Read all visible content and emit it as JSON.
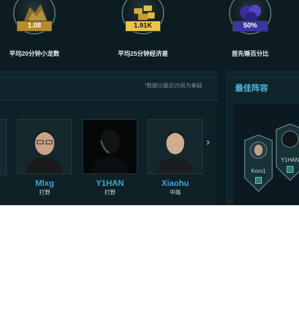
{
  "stats": [
    {
      "value": "1.08",
      "label": "平均20分钟小龙数",
      "icon": "gold-trophy-icon",
      "badge_bg": "#b88a2c",
      "badge_fg": "#ffffff"
    },
    {
      "value": "1.91K",
      "label": "平均25分钟经济差",
      "icon": "gold-coins-icon",
      "badge_bg": "#e9c44a",
      "badge_fg": "#1b1b1b"
    },
    {
      "value": "50%",
      "label": "首先锤百分比",
      "icon": "purple-crystal-icon",
      "badge_bg": "#3b35a6",
      "badge_fg": "#ffffff"
    }
  ],
  "players_panel": {
    "note_star": "*",
    "note": "数据以最近25局为基础",
    "players": [
      {
        "name": "Mlxg",
        "role": "打野"
      },
      {
        "name": "Y1HAN",
        "role": "打野"
      },
      {
        "name": "Xiaohu",
        "role": "中路"
      }
    ]
  },
  "lineup_panel": {
    "title": "最佳阵容",
    "members": [
      {
        "name": "Koro1"
      },
      {
        "name": "Y1HAN"
      }
    ]
  },
  "colors": {
    "background": "#0d1b22",
    "panel": "#10242c",
    "accent_blue": "#4fb6d8",
    "note_red": "#d6413b"
  }
}
